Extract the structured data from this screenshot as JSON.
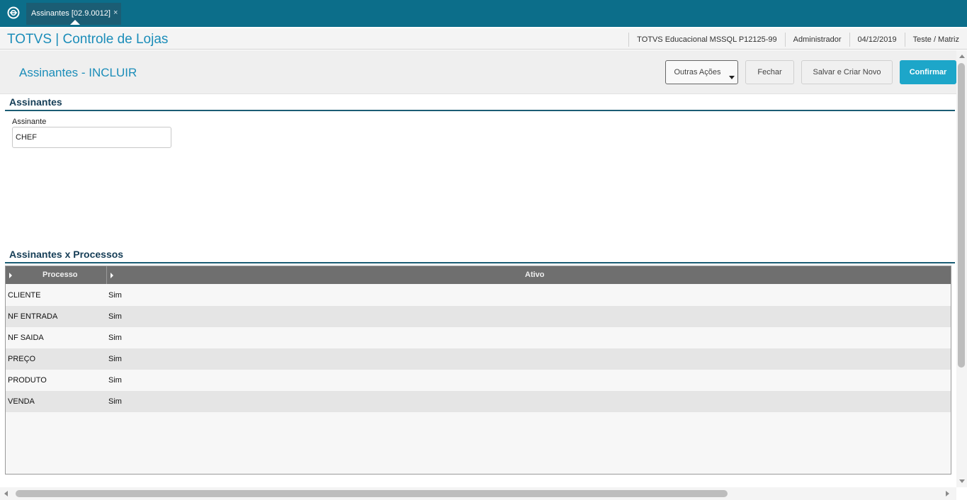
{
  "tab": {
    "label": "Assinantes [02.9.0012]",
    "close": "×"
  },
  "header": {
    "app_title": "TOTVS | Controle de Lojas",
    "info": [
      "TOTVS Educacional MSSQL P12125-99",
      "Administrador",
      "04/12/2019",
      "Teste / Matriz"
    ]
  },
  "page": {
    "title": "Assinantes - INCLUIR"
  },
  "actions": {
    "outras": "Outras Ações",
    "fechar": "Fechar",
    "salvar": "Salvar e Criar Novo",
    "confirmar": "Confirmar"
  },
  "section1": {
    "title": "Assinantes",
    "field_label": "Assinante",
    "field_value": "CHEF"
  },
  "section2": {
    "title": "Assinantes x Processos"
  },
  "grid": {
    "columns": [
      "Processo",
      "Ativo"
    ],
    "rows": [
      [
        "CLIENTE",
        "Sim"
      ],
      [
        "NF ENTRADA",
        "Sim"
      ],
      [
        "NF SAIDA",
        "Sim"
      ],
      [
        "PREÇO",
        "Sim"
      ],
      [
        "PRODUTO",
        "Sim"
      ],
      [
        "VENDA",
        "Sim"
      ]
    ]
  },
  "colors": {
    "topbar": "#0c6e8a",
    "accent": "#1b8db9",
    "confirm": "#1da6c9"
  },
  "icons": [
    "totvs-logo-icon",
    "close-icon",
    "chevron-down-icon",
    "column-arrow-icon"
  ]
}
